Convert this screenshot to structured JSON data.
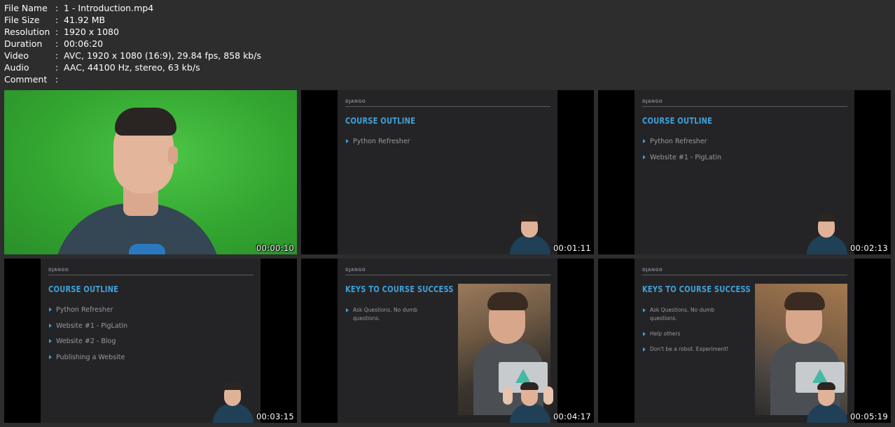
{
  "info": {
    "rows": [
      {
        "label": "File Name",
        "sep": ":",
        "value": "1 - Introduction.mp4"
      },
      {
        "label": "File Size",
        "sep": ":",
        "value": "41.92 MB"
      },
      {
        "label": "Resolution",
        "sep": ":",
        "value": "1920 x 1080"
      },
      {
        "label": "Duration",
        "sep": ":",
        "value": "00:06:20"
      },
      {
        "label": "Video",
        "sep": ":",
        "value": "AVC, 1920 x 1080 (16:9), 29.84 fps, 858 kb/s"
      },
      {
        "label": "Audio",
        "sep": ":",
        "value": "AAC, 44100 Hz, stereo, 63 kb/s"
      },
      {
        "label": "Comment",
        "sep": ":",
        "value": ""
      }
    ]
  },
  "thumbnails": [
    {
      "timestamp": "00:00:10"
    },
    {
      "timestamp": "00:01:11",
      "brand": "DJANGO",
      "title": "COURSE OUTLINE",
      "items": [
        "Python Refresher"
      ]
    },
    {
      "timestamp": "00:02:13",
      "brand": "DJANGO",
      "title": "COURSE OUTLINE",
      "items": [
        "Python Refresher",
        "Website #1 - PigLatin"
      ]
    },
    {
      "timestamp": "00:03:15",
      "brand": "DJANGO",
      "title": "COURSE OUTLINE",
      "items": [
        "Python Refresher",
        "Website #1 - PigLatin",
        "Website #2 - Blog",
        "Publishing a Website"
      ]
    },
    {
      "timestamp": "00:04:17",
      "brand": "DJANGO",
      "title": "KEYS TO COURSE SUCCESS",
      "items": [
        "Ask Questions. No dumb questions."
      ]
    },
    {
      "timestamp": "00:05:19",
      "brand": "DJANGO",
      "title": "KEYS TO COURSE SUCCESS",
      "items": [
        "Ask Questions. No dumb questions.",
        "Help others",
        "Don't be a robot. Experiment!"
      ]
    }
  ],
  "colors": {
    "background": "#2d2d2d",
    "slide_background": "#242427",
    "slide_accent": "#3ea0d8",
    "green_screen": "#34a932"
  }
}
